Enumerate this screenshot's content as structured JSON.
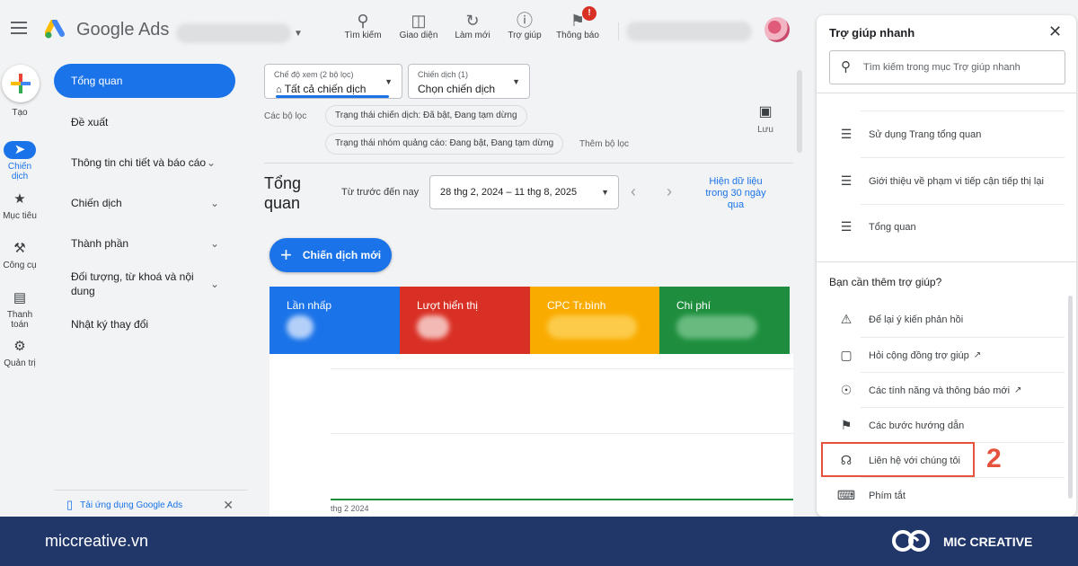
{
  "header": {
    "logo_text": "Google Ads",
    "tools": [
      {
        "icon": "search-icon",
        "label": "Tìm kiếm"
      },
      {
        "icon": "appearance-icon",
        "label": "Giao diện"
      },
      {
        "icon": "refresh-icon",
        "label": "Làm mới"
      },
      {
        "icon": "help-icon",
        "label": "Trợ giúp"
      },
      {
        "icon": "bell-icon",
        "label": "Thông báo",
        "badge": "!"
      }
    ]
  },
  "rail": {
    "create_label": "Tạo",
    "items": [
      {
        "icon": "megaphone-icon",
        "label": "Chiến dịch",
        "active": true
      },
      {
        "icon": "trophy-icon",
        "label": "Mục tiêu"
      },
      {
        "icon": "tools-icon",
        "label": "Công cụ"
      },
      {
        "icon": "card-icon",
        "label": "Thanh toán"
      },
      {
        "icon": "gear-icon",
        "label": "Quản trị"
      }
    ]
  },
  "nav": {
    "items": [
      {
        "label": "Tổng quan",
        "active": true
      },
      {
        "label": "Đề xuất"
      },
      {
        "label": "Thông tin chi tiết và báo cáo",
        "chevron": true
      },
      {
        "label": "Chiến dịch",
        "chevron": true
      },
      {
        "label": "Thành phần",
        "chevron": true
      },
      {
        "label": "Đối tượng, từ khoá và nội dung",
        "chevron": true
      },
      {
        "label": "Nhật ký thay đổi"
      }
    ],
    "app_download": "Tải ứng dụng Google Ads"
  },
  "main": {
    "view_mode": {
      "label": "Chế độ xem (2 bộ lọc)",
      "value": "Tất cả chiến dịch"
    },
    "campaign": {
      "label": "Chiến dịch (1)",
      "value": "Chọn chiến dịch"
    },
    "filters_label": "Các bộ lọc",
    "filter_chips": [
      "Trạng thái chiến dịch: Đã bật, Đang tạm dừng",
      "Trạng thái nhóm quảng cáo: Đang bật, Đang tạm dừng"
    ],
    "add_filter": "Thêm bộ lọc",
    "save_label": "Lưu",
    "title": "Tổng quan",
    "range_label": "Từ trước đến nay",
    "date_range": "28 thg 2, 2024 – 11 thg 8, 2025",
    "last30": "Hiện dữ liệu trong 30 ngày qua",
    "new_campaign": "Chiến dịch mới",
    "metrics": [
      {
        "label": "Lần nhấp",
        "color": "#1a73e8"
      },
      {
        "label": "Lượt hiển thị",
        "color": "#d93025"
      },
      {
        "label": "CPC Tr.bình",
        "color": "#f9ab00"
      },
      {
        "label": "Chi phí",
        "color": "#1e8e3e"
      }
    ],
    "x_label": "thg 2 2024"
  },
  "help": {
    "title": "Trợ giúp nhanh",
    "search_placeholder": "Tìm kiếm trong mục Trợ giúp nhanh",
    "articles": [
      "Sử dụng Trang tổng quan",
      "Giới thiệu về phạm vi tiếp cận tiếp thị lại",
      "Tổng quan"
    ],
    "more_title": "Bạn cần thêm trợ giúp?",
    "options": [
      {
        "icon": "feedback-icon",
        "label": "Để lại ý kiến phản hồi"
      },
      {
        "icon": "forum-icon",
        "label": "Hỏi cộng đồng trợ giúp",
        "external": true
      },
      {
        "icon": "new-features-icon",
        "label": "Các tính năng và thông báo mới",
        "external": true
      },
      {
        "icon": "flag-icon",
        "label": "Các bước hướng dẫn"
      },
      {
        "icon": "headset-icon",
        "label": "Liên hệ với chúng tôi"
      },
      {
        "icon": "keyboard-icon",
        "label": "Phím tắt"
      }
    ],
    "step_number": "2"
  },
  "footer": {
    "site": "miccreative.vn",
    "brand": "MIC CREATIVE"
  },
  "colors": {
    "accent": "#1a73e8",
    "highlight": "#e5533d",
    "footer": "#213669"
  }
}
